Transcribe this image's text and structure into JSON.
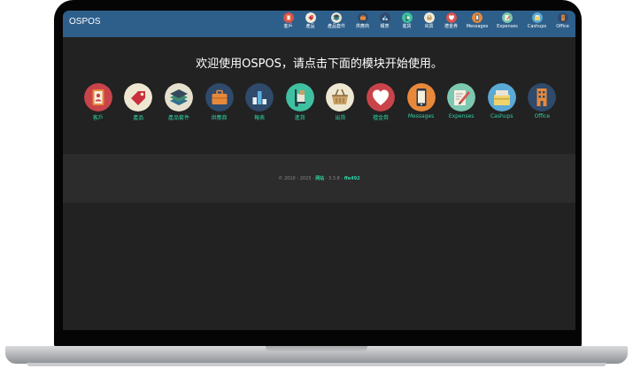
{
  "app": {
    "brand": "OSPOS",
    "accent_color": "#2ed3a6",
    "navbar_color": "#2d5f8a",
    "background_color": "#222222"
  },
  "navbar": {
    "items": [
      {
        "label": "客戶",
        "icon": "customers-icon"
      },
      {
        "label": "產品",
        "icon": "items-icon"
      },
      {
        "label": "產品套件",
        "icon": "item-kits-icon"
      },
      {
        "label": "供應商",
        "icon": "suppliers-icon"
      },
      {
        "label": "報表",
        "icon": "reports-icon"
      },
      {
        "label": "進貨",
        "icon": "receivings-icon"
      },
      {
        "label": "出貨",
        "icon": "sales-icon"
      },
      {
        "label": "禮金券",
        "icon": "giftcards-icon"
      },
      {
        "label": "Messages",
        "icon": "messages-icon"
      },
      {
        "label": "Expenses",
        "icon": "expenses-icon"
      },
      {
        "label": "Cashups",
        "icon": "cashups-icon"
      },
      {
        "label": "Office",
        "icon": "office-icon"
      }
    ]
  },
  "welcome": {
    "message": "欢迎使用OSPOS，请点击下面的模块开始使用。"
  },
  "modules": [
    {
      "label": "客戶",
      "icon": "customers-icon"
    },
    {
      "label": "產品",
      "icon": "items-icon"
    },
    {
      "label": "產品套件",
      "icon": "item-kits-icon"
    },
    {
      "label": "供應商",
      "icon": "suppliers-icon"
    },
    {
      "label": "報表",
      "icon": "reports-icon"
    },
    {
      "label": "進貨",
      "icon": "receivings-icon"
    },
    {
      "label": "出貨",
      "icon": "sales-icon"
    },
    {
      "label": "禮金券",
      "icon": "giftcards-icon"
    },
    {
      "label": "Messages",
      "icon": "messages-icon"
    },
    {
      "label": "Expenses",
      "icon": "expenses-icon"
    },
    {
      "label": "Cashups",
      "icon": "cashups-icon"
    },
    {
      "label": "Office",
      "icon": "office-icon"
    }
  ],
  "footer": {
    "prefix": "© 2010 - 2023 · ",
    "website": "网站",
    "separator": " · 3.3.8 - ",
    "commit": "ffe492"
  }
}
